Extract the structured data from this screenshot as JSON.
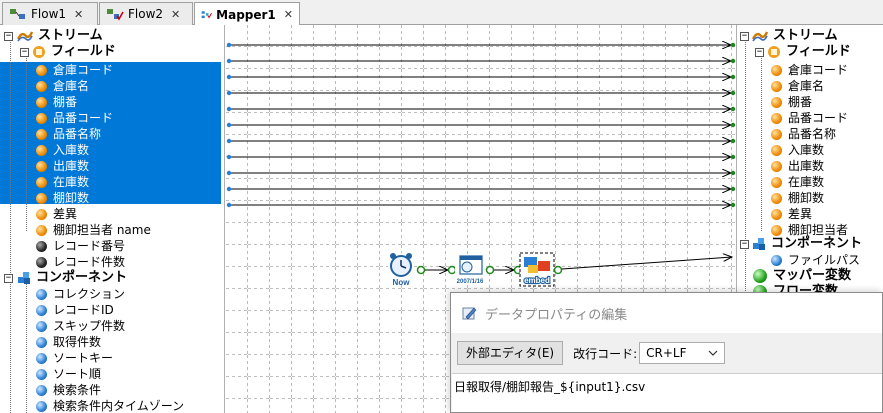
{
  "tabs": [
    {
      "label": "Flow1",
      "close": "✕",
      "active": false
    },
    {
      "label": "Flow2",
      "close": "✕",
      "active": false
    },
    {
      "label": "Mapper1",
      "close": "✕",
      "active": true
    }
  ],
  "left_tree": {
    "stream": "ストリーム",
    "field": "フィールド",
    "fields": [
      "倉庫コード",
      "倉庫名",
      "棚番",
      "品番コード",
      "品番名称",
      "入庫数",
      "出庫数",
      "在庫数",
      "棚卸数",
      "差異",
      "棚卸担当者 name"
    ],
    "record_no": "レコード番号",
    "record_count": "レコード件数",
    "component": "コンポーネント",
    "component_items": [
      "コレクション",
      "レコードID",
      "スキップ件数",
      "取得件数",
      "ソートキー",
      "ソート順",
      "検索条件",
      "検索条件内タイムゾーン"
    ]
  },
  "right_tree": {
    "stream": "ストリーム",
    "field": "フィールド",
    "fields": [
      "倉庫コード",
      "倉庫名",
      "棚番",
      "品番コード",
      "品番名称",
      "入庫数",
      "出庫数",
      "在庫数",
      "棚卸数",
      "差異",
      "棚卸担当者"
    ],
    "component": "コンポーネント",
    "file_path": "ファイルパス",
    "mapper_vars": "マッパー変数",
    "flow_vars": "フロー変数"
  },
  "canvas": {
    "now_label": "Now",
    "date_label": "2007/1/16",
    "embed_label": "embed"
  },
  "dialog": {
    "title": "データプロパティの編集",
    "external_editor": "外部エディタ(E)",
    "newline_label": "改行コード:",
    "newline_value": "CR+LF",
    "editor_text": "日報取得/棚卸報告_${input1}.csv"
  },
  "colors": {
    "selection": "#0078d7",
    "field_icon": "#f08a00",
    "dialog_bg": "#f0f0f0"
  },
  "selected_field_count": 9
}
